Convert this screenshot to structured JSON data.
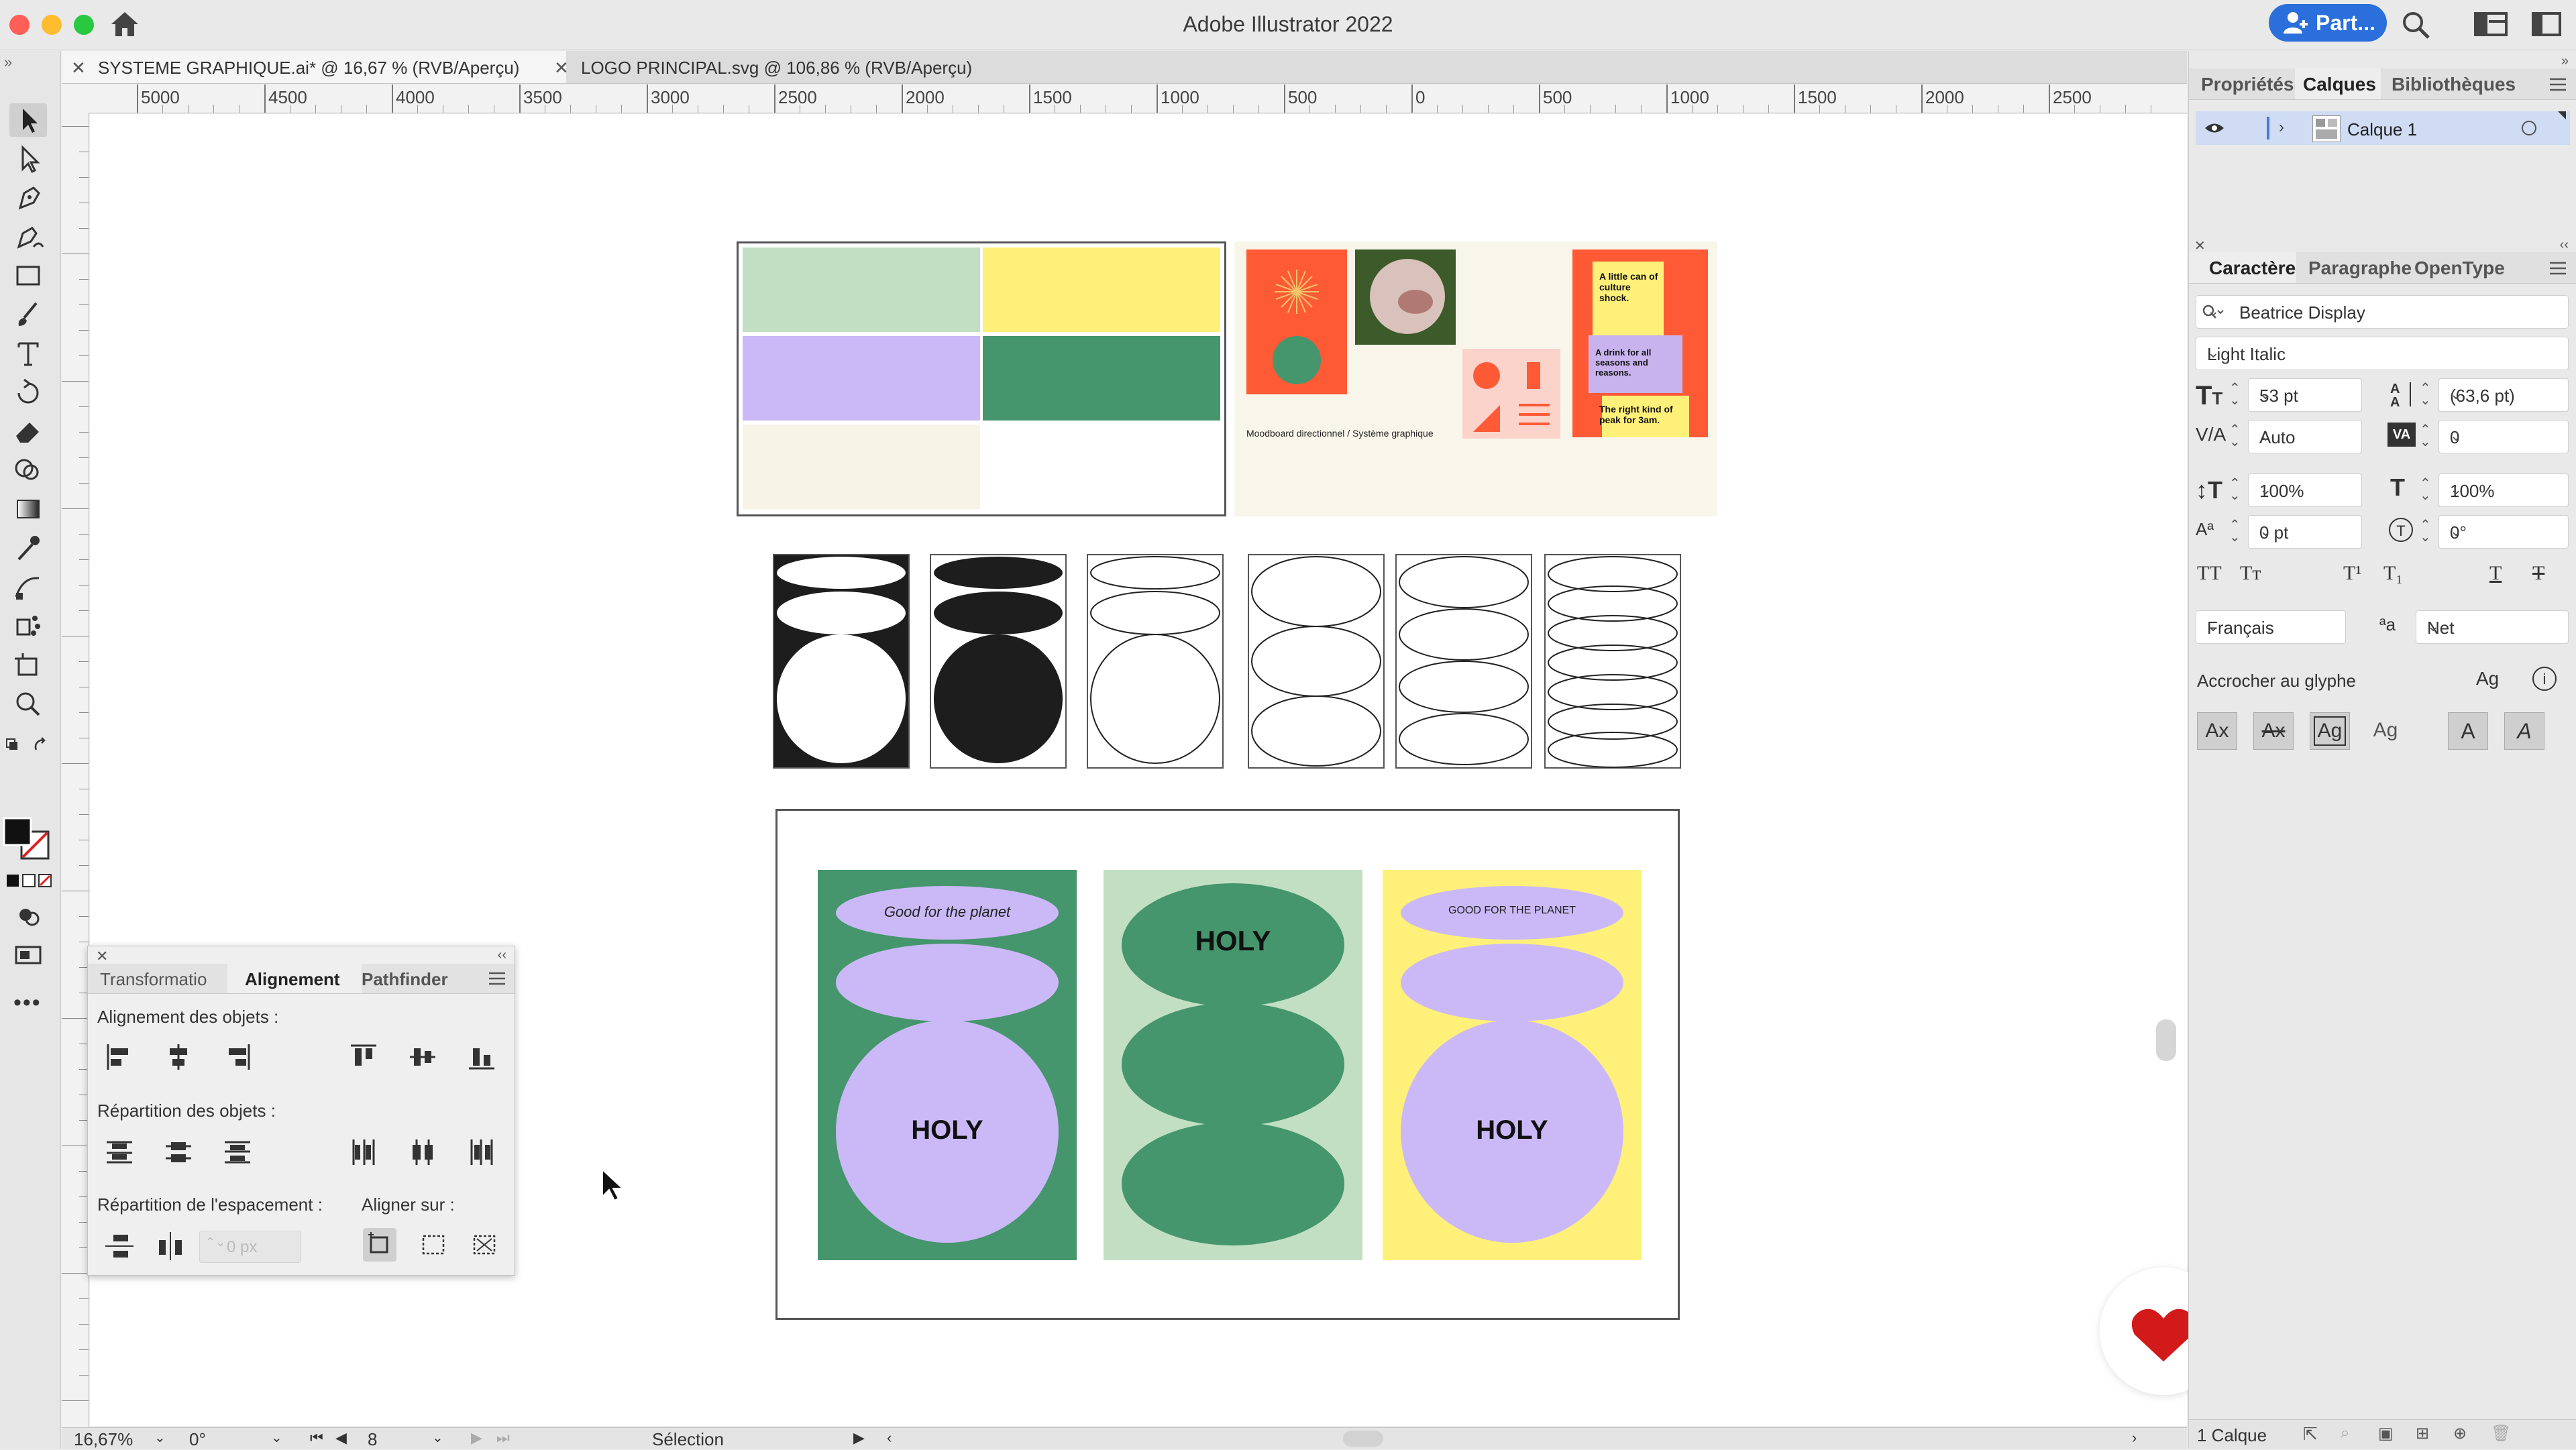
{
  "window": {
    "title": "Adobe Illustrator 2022",
    "share_label": "Part..."
  },
  "doc_tabs": [
    {
      "label": "SYSTEME GRAPHIQUE.ai* @ 16,67 % (RVB/Aperçu)",
      "active": true
    },
    {
      "label": "LOGO PRINCIPAL.svg @ 106,86 % (RVB/Aperçu)",
      "active": false
    }
  ],
  "ruler": {
    "ticks": [
      "5000",
      "4500",
      "4000",
      "3500",
      "3000",
      "2500",
      "2000",
      "1500",
      "1000",
      "500",
      "0",
      "500",
      "1000",
      "1500",
      "2000",
      "2500"
    ]
  },
  "layers_panel": {
    "tabs": [
      "Propriétés",
      "Calques",
      "Bibliothèques"
    ],
    "active_tab": "Calques",
    "layer_name": "Calque 1",
    "footer_count": "1 Calque"
  },
  "character_panel": {
    "tabs": [
      "Caractère",
      "Paragraphe",
      "OpenType"
    ],
    "font_family": "Beatrice Display",
    "font_style": "Light Italic",
    "font_size": "53 pt",
    "leading": "(63,6 pt)",
    "kerning": "Auto",
    "tracking": "0",
    "vertical_scale": "100%",
    "horizontal_scale": "100%",
    "baseline_shift": "0 pt",
    "rotation": "0°",
    "language": "Français",
    "antialias": "Net",
    "snap_label": "Accrocher au glyphe"
  },
  "align_panel": {
    "tabs": [
      "Transformatio",
      "Alignement",
      "Pathfinder"
    ],
    "active_tab": "Alignement",
    "align_objects_label": "Alignement des objets :",
    "distribute_objects_label": "Répartition des objets :",
    "distribute_spacing_label": "Répartition de l'espacement :",
    "align_to_label": "Aligner sur :",
    "spacing_placeholder": "0 px"
  },
  "statusbar": {
    "zoom": "16,67%",
    "rotation": "0°",
    "artboard": "8",
    "tool": "Sélection"
  },
  "artwork": {
    "moodboard_caption": "Moodboard directionnel / Système graphique",
    "poster1_tagline": "Good for the planet",
    "poster3_tagline": "GOOD FOR THE PLANET",
    "holy": "HOLY",
    "can_text_top": "A little can of culture shock.",
    "can_text_mid": "A drink for all seasons and reasons.",
    "can_text_bottom": "The right kind of peak for 3am.",
    "palette": [
      "#c2dfc4",
      "#fff07a",
      "#cbb9f7",
      "#45956d",
      "#f7f4e7",
      "#ffffff"
    ],
    "colors": {
      "green": "#45956d",
      "lavender": "#cbb9f7",
      "mint": "#c2dfc4",
      "yellow": "#fff07a",
      "orange": "#ff5a36"
    }
  }
}
